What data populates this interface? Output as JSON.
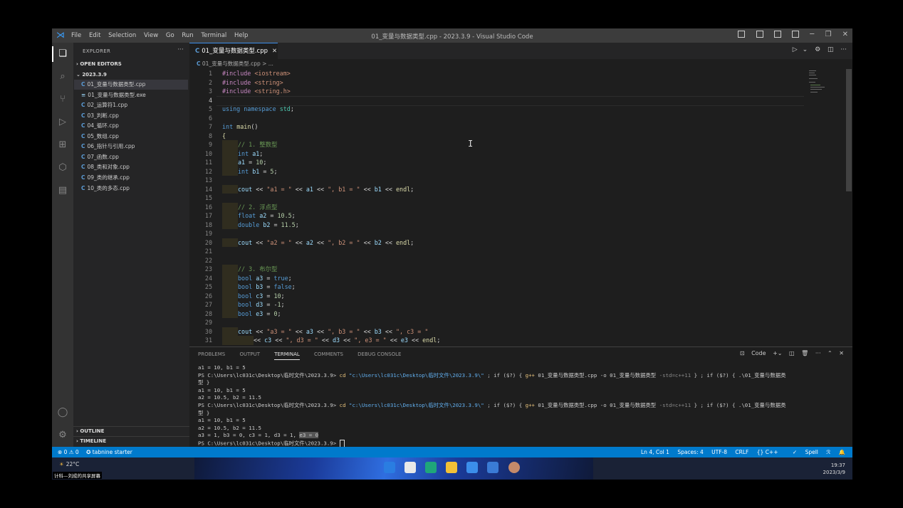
{
  "titlebar": {
    "menu": [
      "File",
      "Edit",
      "Selection",
      "View",
      "Go",
      "Run",
      "Terminal",
      "Help"
    ],
    "title": "01_变量与数据类型.cpp - 2023.3.9 - Visual Studio Code"
  },
  "sidebar": {
    "title": "EXPLORER",
    "open_editors": "OPEN EDITORS",
    "folder": "2023.3.9",
    "files": [
      {
        "name": "01_变量与数据类型.cpp",
        "icon": "C"
      },
      {
        "name": "01_变量与数据类型.exe",
        "icon": "≡"
      },
      {
        "name": "02_运算符1.cpp",
        "icon": "C"
      },
      {
        "name": "03_判断.cpp",
        "icon": "C"
      },
      {
        "name": "04_循环.cpp",
        "icon": "C"
      },
      {
        "name": "05_数组.cpp",
        "icon": "C"
      },
      {
        "name": "06_指针与引用.cpp",
        "icon": "C"
      },
      {
        "name": "07_函数.cpp",
        "icon": "C"
      },
      {
        "name": "08_类和对象.cpp",
        "icon": "C"
      },
      {
        "name": "09_类的继承.cpp",
        "icon": "C"
      },
      {
        "name": "10_类的多态.cpp",
        "icon": "C"
      }
    ],
    "outline": "OUTLINE",
    "timeline": "TIMELINE"
  },
  "editor": {
    "tab": "01_变量与数据类型.cpp",
    "breadcrumb": "01_变量与数据类型.cpp > ..."
  },
  "panel": {
    "tabs": [
      "PROBLEMS",
      "OUTPUT",
      "TERMINAL",
      "COMMENTS",
      "DEBUG CONSOLE"
    ],
    "shell": "Code",
    "lines": {
      "l1": "a1 = 10, b1 = 5",
      "l2_prompt": "PS C:\\Users\\lc031c\\Desktop\\临时文件\\2023.3.9> ",
      "l2_cd": "cd ",
      "l2_path": "\"c:\\Users\\lc031c\\Desktop\\临时文件\\2023.3.9\\\"",
      "l2_if": " ; if ($?) { ",
      "l2_gpp": "g++",
      "l2_args": " 01_变量与数据类型.cpp -o 01_变量与数据类型 ",
      "l2_flag": "-std=c++11",
      "l2_end": " } ; if ($?) { .\\01_变量与数据类",
      "l3": "型 }",
      "l4": "a1 = 10, b1 = 5",
      "l5": "a2 = 10.5, b2 = 11.5",
      "l6_prompt": "PS C:\\Users\\lc031c\\Desktop\\临时文件\\2023.3.9> ",
      "l6_cd": "cd ",
      "l6_path": "\"c:\\Users\\lc031c\\Desktop\\临时文件\\2023.3.9\\\"",
      "l6_if": " ; if ($?) { ",
      "l6_gpp": "g++",
      "l6_args": " 01_变量与数据类型.cpp -o 01_变量与数据类型 ",
      "l6_flag": "-std=c++11",
      "l6_end": " } ; if ($?) { .\\01_变量与数据类",
      "l7": "型 }",
      "l8": "a1 = 10, b1 = 5",
      "l9": "a2 = 10.5, b2 = 11.5",
      "l10a": "a3 = 1, b3 = 0, c3 = 1, d3 = 1, ",
      "l10b": "e3 = 0",
      "l11": "PS C:\\Users\\lc031c\\Desktop\\临时文件\\2023.3.9> "
    }
  },
  "status": {
    "problems": "⊗ 0 ⚠ 0",
    "tabnine": "✪ tabnine starter",
    "position": "Ln 4, Col 1",
    "spaces": "Spaces: 4",
    "encoding": "UTF-8",
    "eol": "CRLF",
    "language": "{} C++",
    "spell": "Spell"
  },
  "taskbar": {
    "temperature": "22°C",
    "subtitle": "计科—刘成的共享屏幕",
    "time": "19:37",
    "date": "2023/3/9"
  },
  "colors": {
    "accent": "#007acc",
    "titlebar": "#3c3c3c",
    "editor_bg": "#1e1e1e",
    "sidebar_bg": "#252526"
  }
}
